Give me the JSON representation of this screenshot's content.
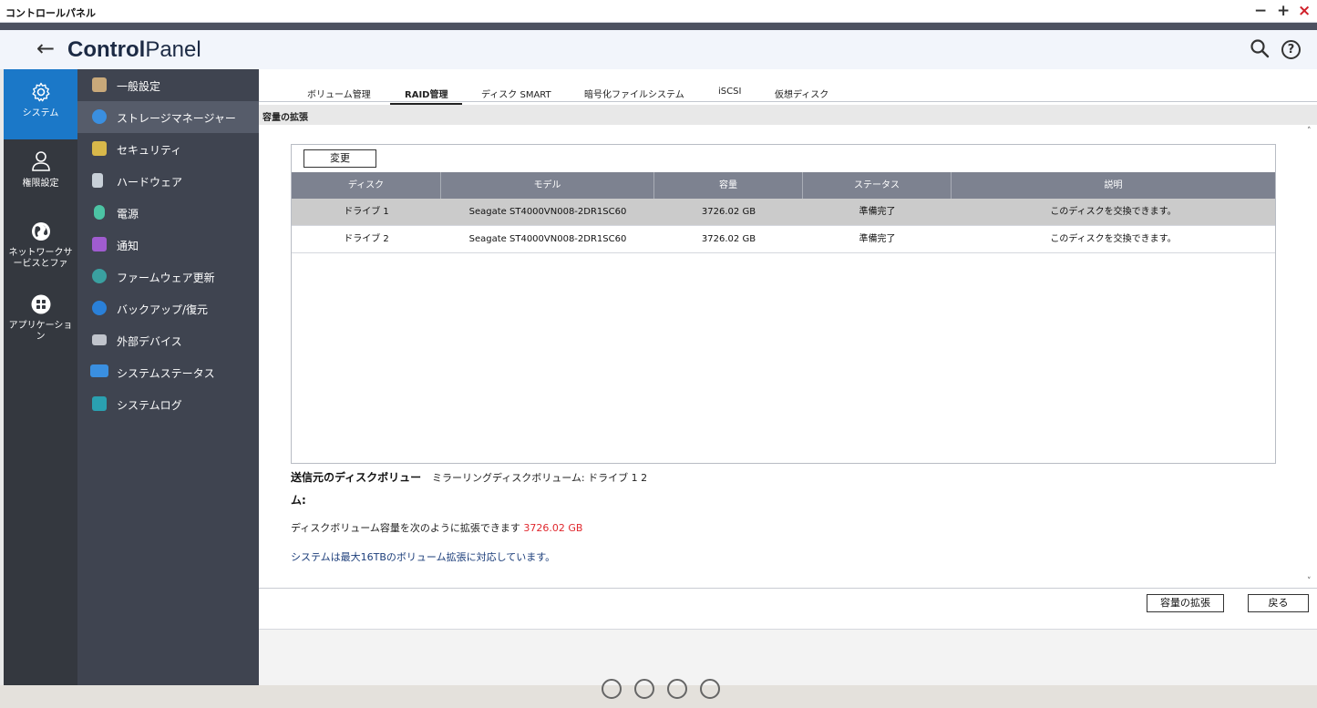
{
  "window": {
    "title": "コントロールパネル",
    "minimize": "−",
    "maximize": "+",
    "close": "×"
  },
  "header": {
    "back": "←",
    "title_bold": "Control",
    "title_light": "Panel",
    "help": "?"
  },
  "rail": [
    {
      "label": "システム",
      "icon": "gear-icon",
      "active": true
    },
    {
      "label": "権限設定",
      "icon": "user-icon",
      "active": false
    },
    {
      "label": "ネットワークサービスとファ",
      "icon": "globe-icon",
      "active": false
    },
    {
      "label": "アプリケーション",
      "icon": "apps-icon",
      "active": false
    }
  ],
  "menu": [
    {
      "label": "一般設定",
      "icon": "general-settings-icon",
      "color": "#c9a97a",
      "active": false
    },
    {
      "label": "ストレージマネージャー",
      "icon": "storage-icon",
      "color": "#3a8fe0",
      "active": true
    },
    {
      "label": "セキュリティ",
      "icon": "lock-icon",
      "color": "#d8b84a",
      "active": false
    },
    {
      "label": "ハードウェア",
      "icon": "hardware-icon",
      "color": "#c8d0d8",
      "active": false
    },
    {
      "label": "電源",
      "icon": "power-icon",
      "color": "#4cc4a4",
      "active": false
    },
    {
      "label": "通知",
      "icon": "notification-icon",
      "color": "#a05cd0",
      "active": false
    },
    {
      "label": "ファームウェア更新",
      "icon": "firmware-icon",
      "color": "#3aa0a0",
      "active": false
    },
    {
      "label": "バックアップ/復元",
      "icon": "backup-icon",
      "color": "#2a80d8",
      "active": false
    },
    {
      "label": "外部デバイス",
      "icon": "external-device-icon",
      "color": "#c0c4cc",
      "active": false
    },
    {
      "label": "システムステータス",
      "icon": "monitor-icon",
      "color": "#3a8fe0",
      "active": false
    },
    {
      "label": "システムログ",
      "icon": "log-icon",
      "color": "#2aa0b0",
      "active": false
    }
  ],
  "tabs": [
    {
      "label": "ボリューム管理",
      "active": false
    },
    {
      "label": "RAID管理",
      "active": true
    },
    {
      "label": "ディスク SMART",
      "active": false
    },
    {
      "label": "暗号化ファイルシステム",
      "active": false
    },
    {
      "label": "iSCSI",
      "active": false
    },
    {
      "label": "仮想ディスク",
      "active": false
    }
  ],
  "section_title": "容量の拡張",
  "table": {
    "change_button": "変更",
    "columns": [
      "ディスク",
      "モデル",
      "容量",
      "ステータス",
      "説明"
    ],
    "rows": [
      [
        "ドライブ 1",
        "Seagate ST4000VN008-2DR1SC60",
        "3726.02 GB",
        "準備完了",
        "このディスクを交換できます。"
      ],
      [
        "ドライブ 2",
        "Seagate ST4000VN008-2DR1SC60",
        "3726.02 GB",
        "準備完了",
        "このディスクを交換できます。"
      ]
    ]
  },
  "info": {
    "source_label_1": "送信元のディスクボリュー",
    "source_label_2": "ム:",
    "source_value": "ミラーリングディスクボリューム: ドライブ 1 2",
    "expand_text": "ディスクボリューム容量を次のように拡張できます",
    "expand_value": "3726.02 GB",
    "limit_text": "システムは最大16TBのボリューム拡張に対応しています。"
  },
  "footer": {
    "expand_button": "容量の拡張",
    "back_button": "戻る"
  },
  "colors": {
    "accent": "#1b78c8",
    "rail_bg": "#34383f",
    "menu_bg": "#3f4450",
    "table_header": "#7d8290",
    "highlight_red": "#e0282e"
  }
}
